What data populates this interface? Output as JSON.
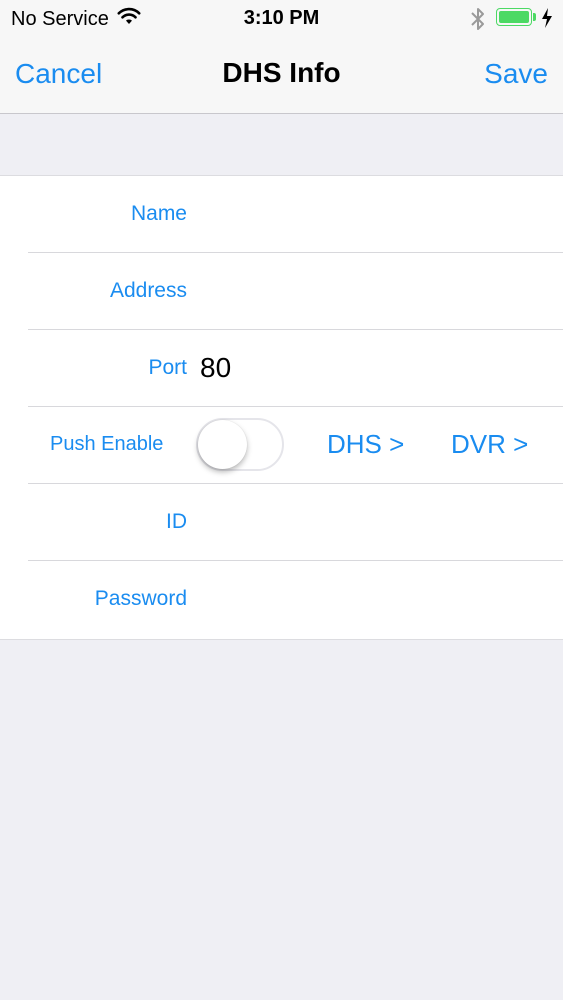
{
  "status_bar": {
    "carrier": "No Service",
    "time": "3:10 PM",
    "wifi_icon": "wifi-icon",
    "bluetooth_icon": "bluetooth-icon",
    "battery_icon": "battery-icon",
    "charging_icon": "charging-bolt-icon",
    "battery_color": "#4cd964"
  },
  "nav": {
    "cancel_label": "Cancel",
    "title": "DHS Info",
    "save_label": "Save",
    "accent_color": "#1a8cf0"
  },
  "form": {
    "name": {
      "label": "Name",
      "value": ""
    },
    "address": {
      "label": "Address",
      "value": ""
    },
    "port": {
      "label": "Port",
      "value": "80"
    },
    "push": {
      "label": "Push Enable",
      "enabled": false,
      "dhs_link": "DHS >",
      "dvr_link": "DVR >"
    },
    "id": {
      "label": "ID",
      "value": ""
    },
    "password": {
      "label": "Password",
      "value": ""
    }
  }
}
